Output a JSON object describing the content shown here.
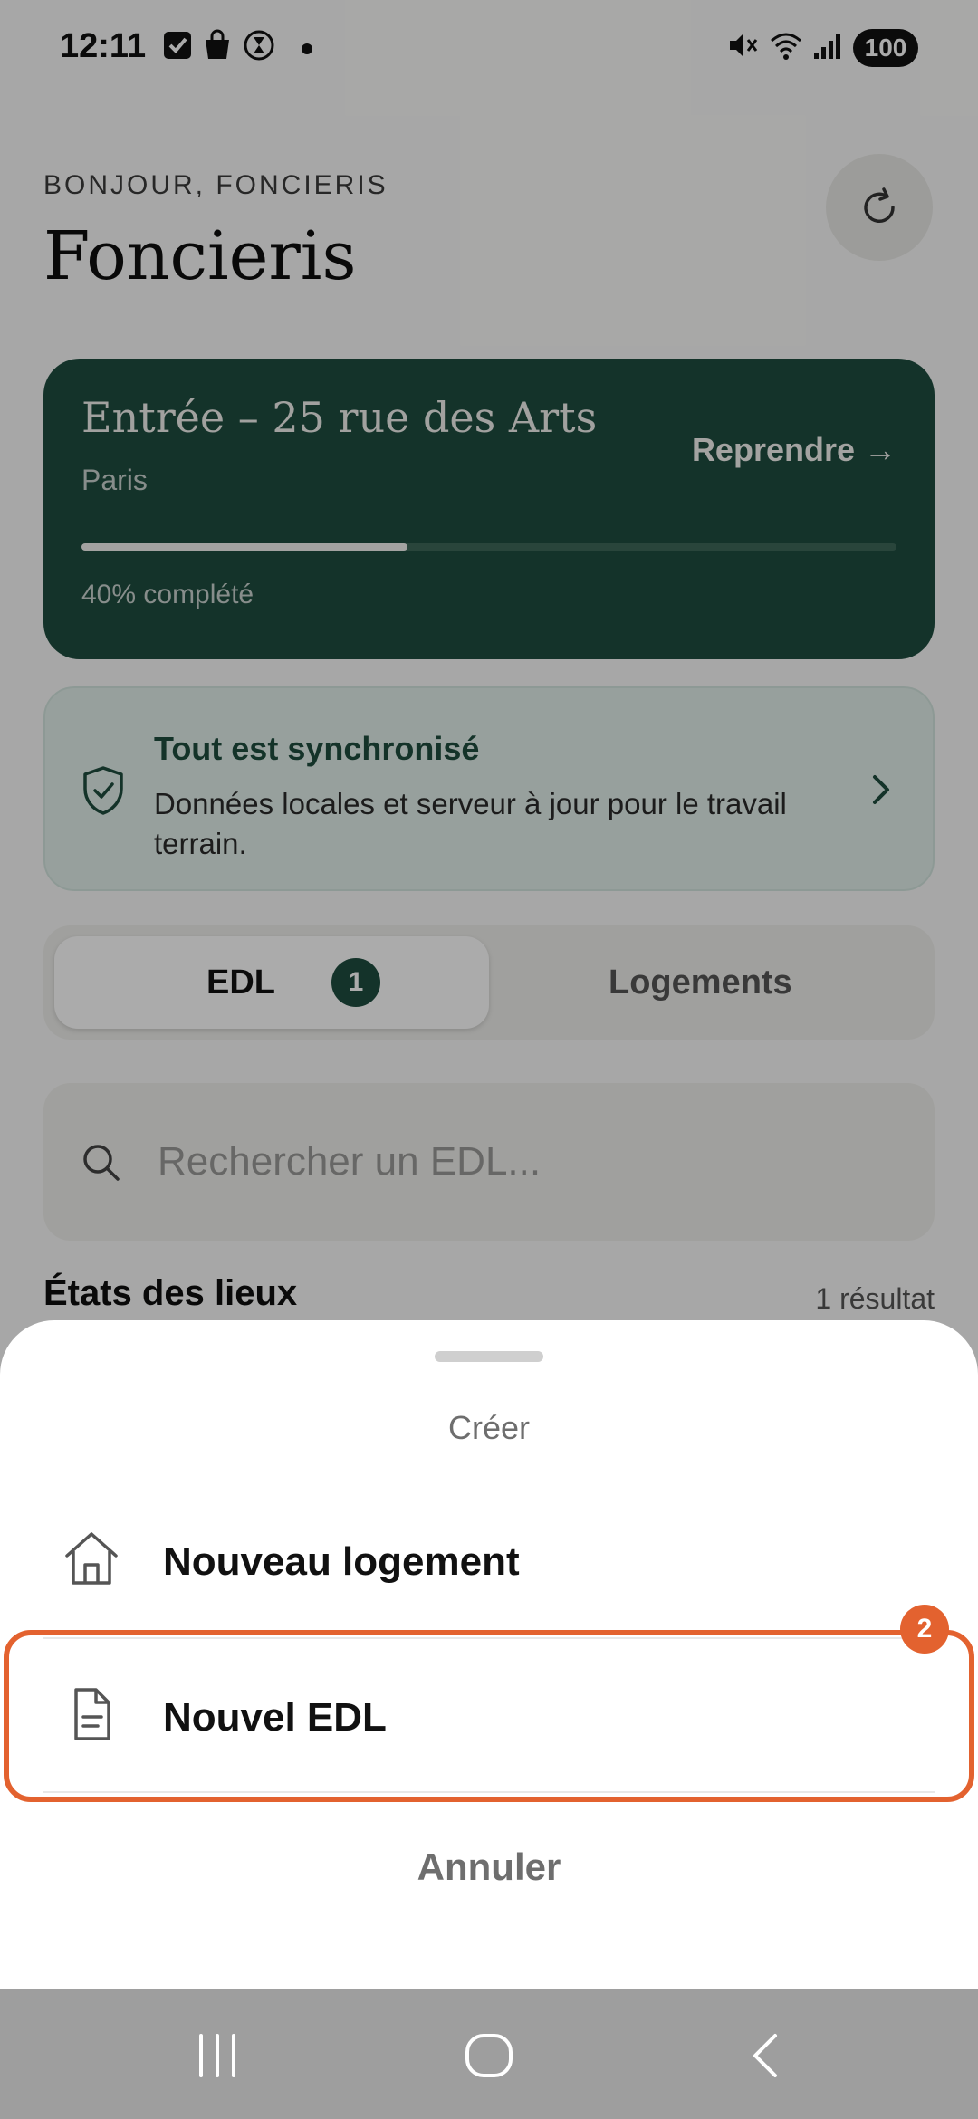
{
  "status_bar": {
    "time": "12:11",
    "battery": "100",
    "left_icons": [
      "checkbox-icon",
      "shopping-bag-icon",
      "hourglass-icon",
      "dot-icon"
    ],
    "right_icons": [
      "mute-icon",
      "wifi-icon",
      "signal-icon"
    ]
  },
  "header": {
    "greeting": "BONJOUR, FONCIERIS",
    "title": "Foncieris",
    "refresh_icon": "refresh-icon"
  },
  "resume_card": {
    "title": "Entrée – 25 rue des Arts",
    "city": "Paris",
    "action": "Reprendre →",
    "progress": 0.4,
    "progress_label": "40% complété",
    "colors": {
      "background": "#1f4d3f",
      "fill": "#f3f3f0"
    }
  },
  "sync_card": {
    "icon": "shield-check-icon",
    "title": "Tout est synchronisé",
    "description": "Données locales et serveur à jour pour le travail terrain.",
    "chevron": "chevron-right-icon"
  },
  "tabs": {
    "edl": {
      "label": "EDL",
      "badge": "1",
      "active": true
    },
    "logements": {
      "label": "Logements",
      "active": false
    }
  },
  "search": {
    "placeholder": "Rechercher un EDL..."
  },
  "list_section": {
    "title": "États des lieux",
    "count": "1 résultat"
  },
  "sheet": {
    "title": "Créer",
    "items": [
      {
        "label": "Nouveau logement",
        "icon": "house-icon"
      },
      {
        "label": "Nouvel EDL",
        "icon": "document-icon"
      }
    ],
    "highlight_badge": "2",
    "cancel": "Annuler",
    "accent_color": "#e3622f"
  },
  "nav": {
    "icons": [
      "recent-apps-icon",
      "home-icon",
      "back-icon"
    ]
  }
}
